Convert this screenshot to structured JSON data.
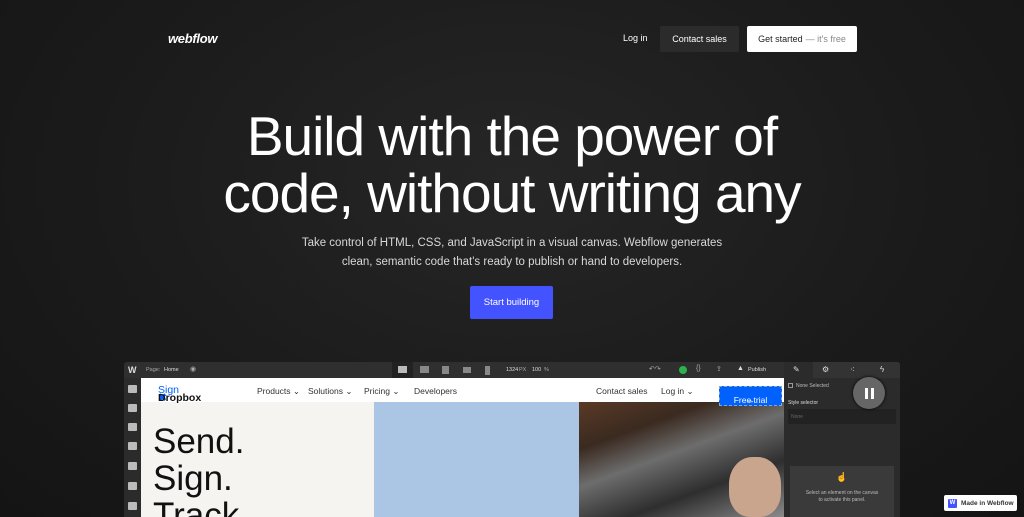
{
  "header": {
    "logo": "webflow",
    "login": "Log in",
    "contact": "Contact sales",
    "get_started": "Get started",
    "get_started_suffix": "— it's free"
  },
  "hero": {
    "title_line1": "Build with the power of",
    "title_line2": "code, without writing any",
    "subtitle_line1": "Take control of HTML, CSS, and JavaScript in a visual canvas. Webflow generates",
    "subtitle_line2": "clean, semantic code that's ready to publish or hand to developers.",
    "cta": "Start building",
    "cta_color": "#4353ff"
  },
  "designer": {
    "logo": "W",
    "page_label": "Page:",
    "page_name": "Home",
    "width": "1324",
    "width_unit": "PX",
    "zoom": "100",
    "zoom_unit": "%",
    "publish": "Publish",
    "site_nav": {
      "brand": "Dropbox",
      "brand_suffix": "Sign",
      "items": [
        "Products ⌄",
        "Solutions ⌄",
        "Pricing ⌄",
        "Developers"
      ],
      "contact": "Contact sales",
      "login": "Log in ⌄",
      "free_trial": "Free trial",
      "free_trial_arrow": "→"
    },
    "hero_lines": [
      "Send.",
      "Sign.",
      "Track."
    ],
    "panel": {
      "none_selected": "None Selected",
      "style_selector": "Style selector",
      "selector_placeholder": "None",
      "hint_line1": "Select an element on the canvas",
      "hint_line2": "to activate this panel."
    }
  },
  "badge": {
    "label": "Made in Webflow",
    "icon": "W"
  }
}
